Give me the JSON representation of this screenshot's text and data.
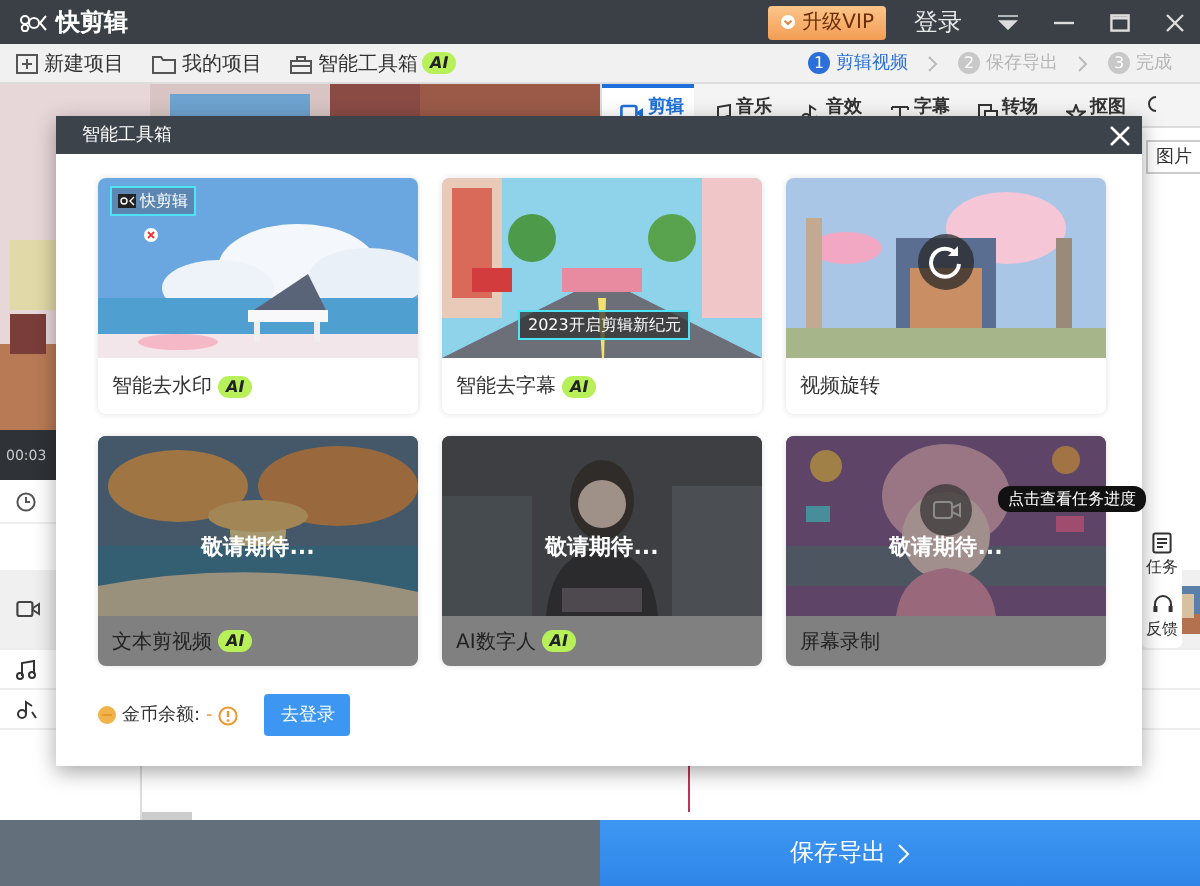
{
  "window": {
    "logo": "快剪辑",
    "vip_button": "升级VIP",
    "login": "登录"
  },
  "toolbar": {
    "items": [
      {
        "label": "新建项目",
        "kind": "new"
      },
      {
        "label": "我的项目",
        "kind": "folder"
      },
      {
        "label": "智能工具箱",
        "kind": "box",
        "badge": "AI"
      }
    ],
    "steps": [
      {
        "number": "1",
        "label": "剪辑视频",
        "selected": true
      },
      {
        "number": "2",
        "label": "保存导出",
        "selected": false
      },
      {
        "number": "3",
        "label": "完成",
        "selected": false
      }
    ]
  },
  "editor_tabs": [
    {
      "label": "剪辑",
      "kind": "video",
      "selected": true
    },
    {
      "label": "音乐",
      "kind": "music",
      "selected": false
    },
    {
      "label": "音效",
      "kind": "effect",
      "selected": false
    },
    {
      "label": "字幕",
      "kind": "text",
      "selected": false
    },
    {
      "label": "转场",
      "kind": "transition",
      "selected": false
    },
    {
      "label": "抠图",
      "kind": "cutout",
      "selected": false
    }
  ],
  "side_button": "图片",
  "preview": {
    "time": "00:03"
  },
  "dialog": {
    "title": "智能工具箱",
    "tools": [
      {
        "kind": "watermark",
        "name": "智能去水印",
        "badge": "AI",
        "available": true,
        "sample_text": "快剪辑"
      },
      {
        "kind": "subtitle",
        "name": "智能去字幕",
        "badge": "AI",
        "available": true,
        "sample_text": "2023开启剪辑新纪元"
      },
      {
        "kind": "rotate",
        "name": "视频旋转",
        "available": true
      },
      {
        "kind": "text-video",
        "name": "文本剪视频",
        "badge": "AI",
        "available": false,
        "overlay": "敬请期待..."
      },
      {
        "kind": "digital-human",
        "name": "AI数字人",
        "badge": "AI",
        "available": false,
        "overlay": "敬请期待..."
      },
      {
        "kind": "screen-record",
        "name": "屏幕录制",
        "available": false,
        "overlay": "敬请期待..."
      }
    ],
    "coins_label": "金币余额:",
    "coins_value": "-",
    "login_button": "去登录"
  },
  "task_panel": {
    "tooltip": "点击查看任务进度",
    "items": [
      {
        "label": "任务",
        "kind": "task"
      },
      {
        "label": "反馈",
        "kind": "headset"
      }
    ]
  },
  "export_button": "保存导出"
}
